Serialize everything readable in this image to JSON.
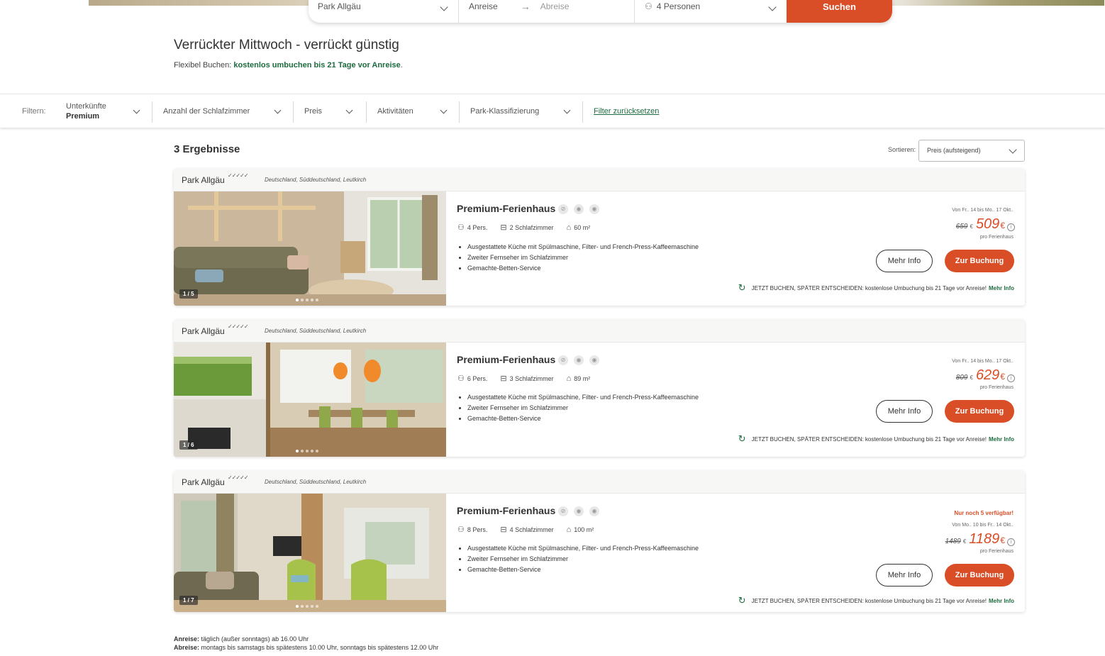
{
  "search": {
    "park": "Park Allgäu",
    "arrival": "Anreise",
    "departure": "Abreise",
    "guests": "4 Personen",
    "search_button": "Suchen"
  },
  "header": {
    "title": "Verrückter Mittwoch - verrückt günstig",
    "flex_prefix": "Flexibel Buchen:",
    "flex_highlight": "kostenlos umbuchen bis 21 Tage vor Anreise",
    "flex_suffix": "."
  },
  "filters": {
    "label": "Filtern:",
    "accommodation_label": "Unterkünfte",
    "accommodation_value": "Premium",
    "bedrooms": "Anzahl der Schlafzimmer",
    "price": "Preis",
    "activities": "Aktivitäten",
    "classification": "Park-Klassifizierung",
    "reset": "Filter zurücksetzen"
  },
  "results": {
    "count": "3 Ergebnisse",
    "sort_label": "Sortieren:",
    "sort_value": "Preis (aufsteigend)"
  },
  "cards": [
    {
      "park": "Park Allgäu",
      "stars": "✓✓✓✓✓",
      "location": "Deutschland,  Süddeutschland,  Leutkirch",
      "image_counter": "1 / 5",
      "title": "Premium-Ferienhaus",
      "persons": "4 Pers.",
      "bedrooms": "2 Schlafzimmer",
      "area": "60 m²",
      "features": [
        "Ausgestattete Küche mit Spülmaschine, Filter- und French-Press-Kaffeemaschine",
        "Zweiter Fernseher im Schlafzimmer",
        "Gemachte-Betten-Service"
      ],
      "availability": "",
      "dates": "Von Fr.. 14 bis Mo.. 17 Okt..",
      "old_price": "659",
      "old_currency": "€",
      "new_price": "509",
      "new_currency": "€",
      "per": "pro Ferienhaus",
      "more_button": "Mehr Info",
      "book_button": "Zur Buchung",
      "promo": "JETZT BUCHEN, SPÄTER ENTSCHEIDEN: kostenlose Umbuchung bis 21 Tage vor Anreise!",
      "promo_link": "Mehr Info"
    },
    {
      "park": "Park Allgäu",
      "stars": "✓✓✓✓✓",
      "location": "Deutschland,  Süddeutschland,  Leutkirch",
      "image_counter": "1 / 6",
      "title": "Premium-Ferienhaus",
      "persons": "6 Pers.",
      "bedrooms": "3 Schlafzimmer",
      "area": "89 m²",
      "features": [
        "Ausgestattete Küche mit Spülmaschine, Filter- und French-Press-Kaffeemaschine",
        "Zweiter Fernseher im Schlafzimmer",
        "Gemachte-Betten-Service"
      ],
      "availability": "",
      "dates": "Von Fr.. 14 bis Mo.. 17 Okt..",
      "old_price": "809",
      "old_currency": "€",
      "new_price": "629",
      "new_currency": "€",
      "per": "pro Ferienhaus",
      "more_button": "Mehr Info",
      "book_button": "Zur Buchung",
      "promo": "JETZT BUCHEN, SPÄTER ENTSCHEIDEN: kostenlose Umbuchung bis 21 Tage vor Anreise!",
      "promo_link": "Mehr Info"
    },
    {
      "park": "Park Allgäu",
      "stars": "✓✓✓✓✓",
      "location": "Deutschland,  Süddeutschland,  Leutkirch",
      "image_counter": "1 / 7",
      "title": "Premium-Ferienhaus",
      "persons": "8 Pers.",
      "bedrooms": "4 Schlafzimmer",
      "area": "100 m²",
      "features": [
        "Ausgestattete Küche mit Spülmaschine, Filter- und French-Press-Kaffeemaschine",
        "Zweiter Fernseher im Schlafzimmer",
        "Gemachte-Betten-Service"
      ],
      "availability": "Nur noch 5 verfügbar!",
      "dates": "Von Mo.. 10 bis Fr.. 14 Okt..",
      "old_price": "1489",
      "old_currency": "€",
      "new_price": "1189",
      "new_currency": "€",
      "per": "pro Ferienhaus",
      "more_button": "Mehr Info",
      "book_button": "Zur Buchung",
      "promo": "JETZT BUCHEN, SPÄTER ENTSCHEIDEN: kostenlose Umbuchung bis 21 Tage vor Anreise!",
      "promo_link": "Mehr Info"
    }
  ],
  "footer": {
    "arrival_label": "Anreise:",
    "arrival_text": " täglich (außer sonntags) ab 16.00 Uhr",
    "departure_label": "Abreise:",
    "departure_text": " montags bis samstags bis spätestens 10.00 Uhr, sonntags bis spätestens 12.00 Uhr"
  },
  "colors": {
    "accent": "#d94e26",
    "green": "#1d6b3f"
  }
}
